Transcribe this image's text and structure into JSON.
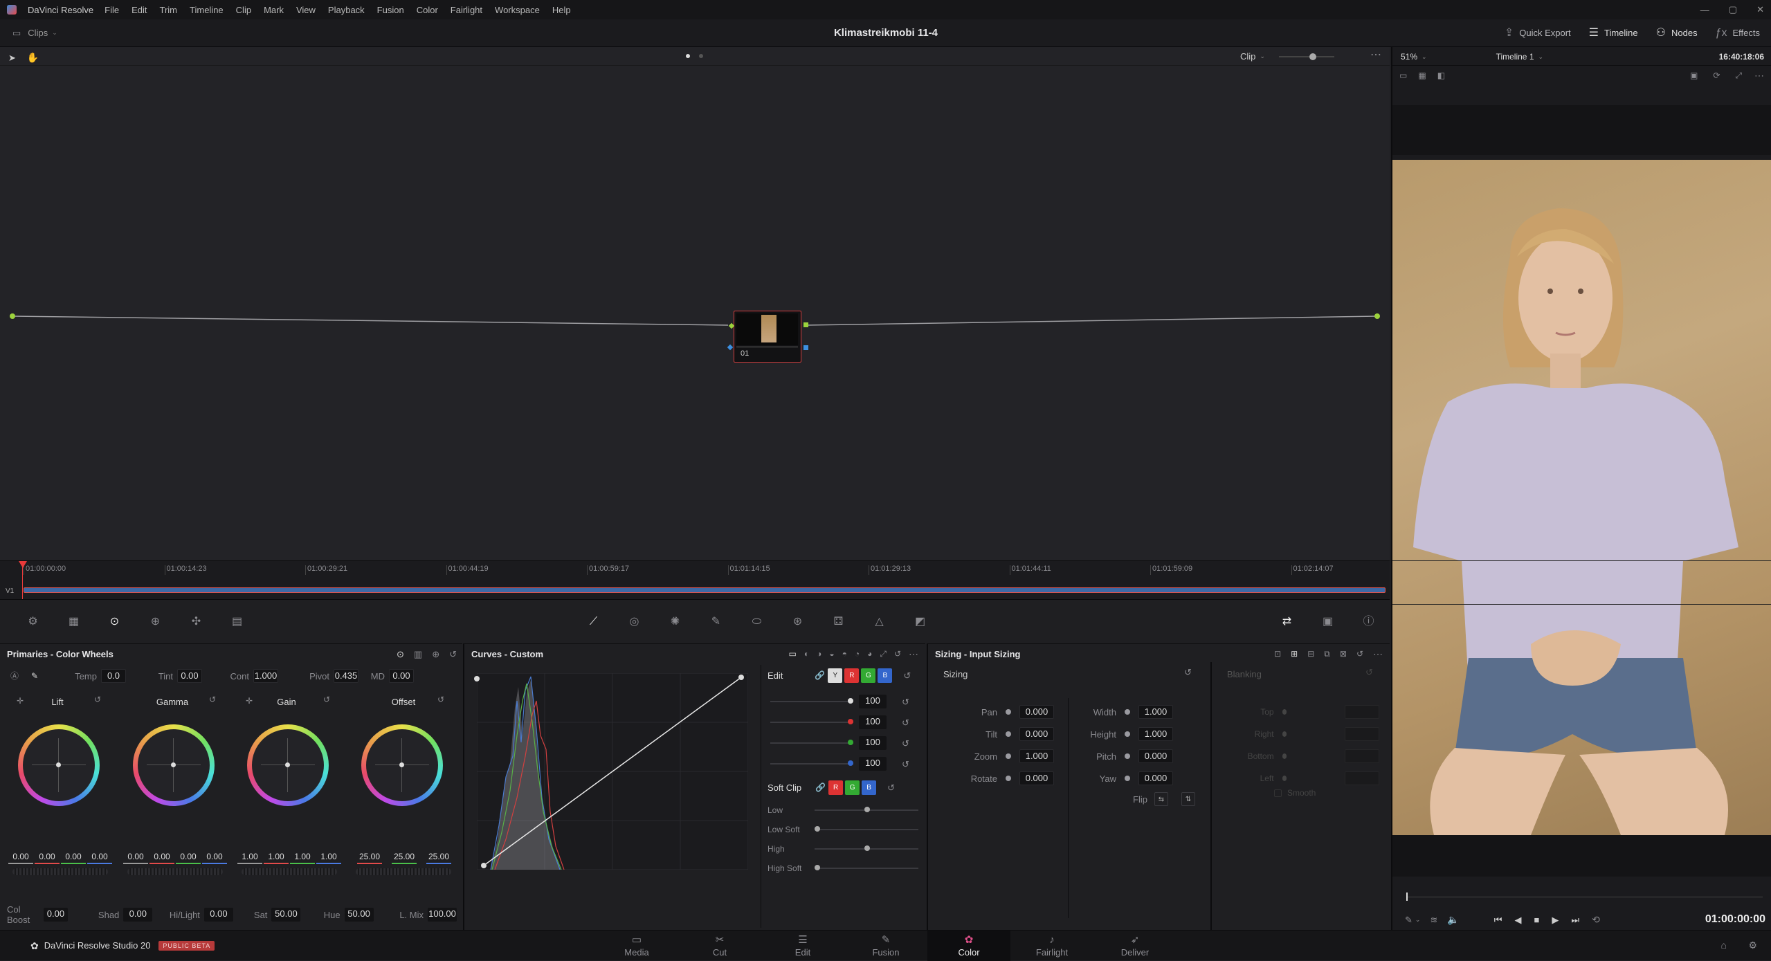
{
  "menubar": {
    "app": "DaVinci Resolve",
    "items": [
      "File",
      "Edit",
      "Trim",
      "Timeline",
      "Clip",
      "Mark",
      "View",
      "Playback",
      "Fusion",
      "Color",
      "Fairlight",
      "Workspace",
      "Help"
    ]
  },
  "toolbar": {
    "clips": "Clips",
    "project_title": "Klimastreikmobi 11-4",
    "quick_export": "Quick Export",
    "timeline": "Timeline",
    "nodes": "Nodes",
    "effects": "Effects"
  },
  "node_header": {
    "clip_mode": "Clip",
    "zoom": "51%",
    "timeline_name": "Timeline 1",
    "timecode": "16:40:18:06"
  },
  "node": {
    "label": "01"
  },
  "ruler": {
    "ticks": [
      "01:00:00:00",
      "01:00:14:23",
      "01:00:29:21",
      "01:00:44:19",
      "01:00:59:17",
      "01:01:14:15",
      "01:01:29:13",
      "01:01:44:11",
      "01:01:59:09",
      "01:02:14:07"
    ],
    "track": "V1"
  },
  "primaries": {
    "title": "Primaries - Color Wheels",
    "top": [
      {
        "label": "Temp",
        "value": "0.0"
      },
      {
        "label": "Tint",
        "value": "0.00"
      },
      {
        "label": "Cont",
        "value": "1.000"
      },
      {
        "label": "Pivot",
        "value": "0.435"
      },
      {
        "label": "MD",
        "value": "0.00"
      }
    ],
    "wheels": [
      {
        "name": "Lift",
        "values": [
          "0.00",
          "0.00",
          "0.00",
          "0.00"
        ]
      },
      {
        "name": "Gamma",
        "values": [
          "0.00",
          "0.00",
          "0.00",
          "0.00"
        ]
      },
      {
        "name": "Gain",
        "values": [
          "1.00",
          "1.00",
          "1.00",
          "1.00"
        ]
      },
      {
        "name": "Offset",
        "values": [
          "25.00",
          "25.00",
          "25.00"
        ]
      }
    ],
    "bottom": [
      {
        "label": "Col Boost",
        "value": "0.00"
      },
      {
        "label": "Shad",
        "value": "0.00"
      },
      {
        "label": "Hi/Light",
        "value": "0.00"
      },
      {
        "label": "Sat",
        "value": "50.00"
      },
      {
        "label": "Hue",
        "value": "50.00"
      },
      {
        "label": "L. Mix",
        "value": "100.00"
      }
    ]
  },
  "curves": {
    "title": "Curves - Custom",
    "edit_label": "Edit",
    "channels": [
      "Y",
      "R",
      "G",
      "B"
    ],
    "intensity": [
      "100",
      "100",
      "100",
      "100"
    ],
    "soft_clip": "Soft Clip",
    "soft_rows": [
      "Low",
      "Low Soft",
      "High",
      "High Soft"
    ]
  },
  "sizing": {
    "title": "Sizing - Input Sizing",
    "sub": "Sizing",
    "left": [
      {
        "label": "Pan",
        "value": "0.000"
      },
      {
        "label": "Tilt",
        "value": "0.000"
      },
      {
        "label": "Zoom",
        "value": "1.000"
      },
      {
        "label": "Rotate",
        "value": "0.000"
      }
    ],
    "right": [
      {
        "label": "Width",
        "value": "1.000"
      },
      {
        "label": "Height",
        "value": "1.000"
      },
      {
        "label": "Pitch",
        "value": "0.000"
      },
      {
        "label": "Yaw",
        "value": "0.000"
      }
    ],
    "flip": "Flip",
    "blanking": "Blanking",
    "blank_rows": [
      "Top",
      "Right",
      "Bottom",
      "Left"
    ],
    "smooth": "Smooth"
  },
  "viewer": {
    "timecode": "01:00:00:00"
  },
  "brand": {
    "name": "DaVinci Resolve Studio 20",
    "badge": "PUBLIC BETA"
  },
  "nav": [
    "Media",
    "Cut",
    "Edit",
    "Fusion",
    "Color",
    "Fairlight",
    "Deliver"
  ],
  "colors": {
    "accent": "#e83a3a",
    "panel": "#1f1f22",
    "dark": "#141416"
  }
}
